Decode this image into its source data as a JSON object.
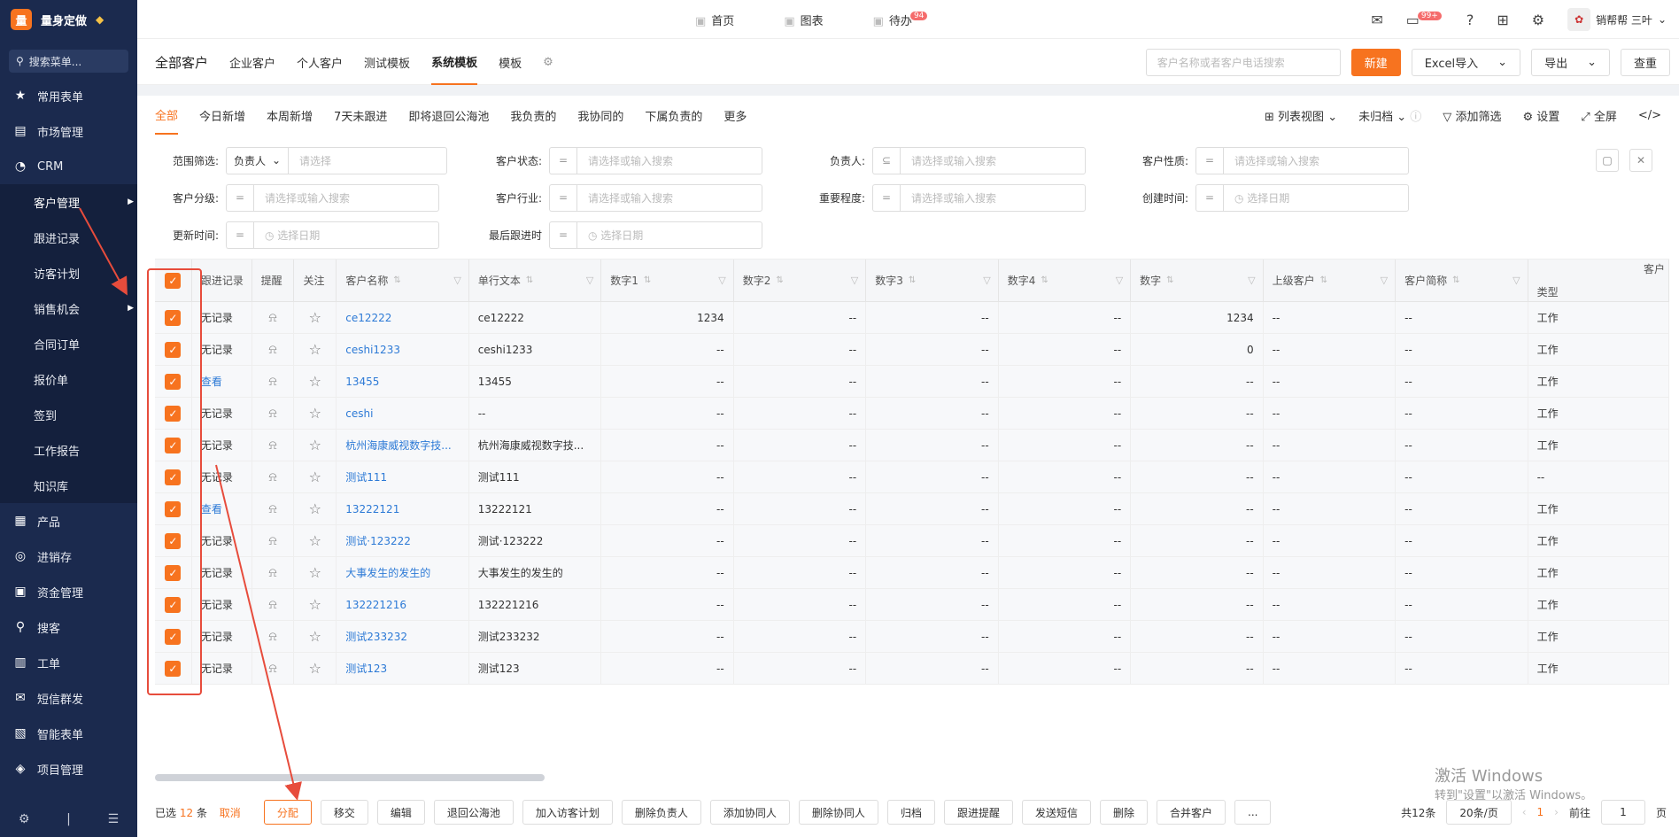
{
  "sidebar": {
    "logo_badge": "量",
    "logo_text": "量身定做",
    "search_placeholder": "搜索菜单...",
    "items": [
      {
        "label": "常用表单",
        "icon": "star-icon",
        "glyph": "★"
      },
      {
        "label": "市场管理",
        "icon": "clipboard-icon",
        "glyph": "▤"
      },
      {
        "label": "CRM",
        "icon": "pie-chart-icon",
        "glyph": "◔"
      }
    ],
    "crm_sub": [
      "客户管理",
      "跟进记录",
      "访客计划",
      "销售机会",
      "合同订单",
      "报价单",
      "签到",
      "工作报告",
      "知识库"
    ],
    "items2": [
      {
        "label": "产品",
        "icon": "cubes-icon",
        "glyph": "▦"
      },
      {
        "label": "进销存",
        "icon": "box-icon",
        "glyph": "◎"
      },
      {
        "label": "资金管理",
        "icon": "money-icon",
        "glyph": "▣"
      },
      {
        "label": "搜客",
        "icon": "search-icon",
        "glyph": "⚲"
      },
      {
        "label": "工单",
        "icon": "ticket-icon",
        "glyph": "▥"
      },
      {
        "label": "短信群发",
        "icon": "mail-icon",
        "glyph": "✉"
      },
      {
        "label": "智能表单",
        "icon": "form-icon",
        "glyph": "▧"
      },
      {
        "label": "项目管理",
        "icon": "layers-icon",
        "glyph": "◈"
      }
    ]
  },
  "topnav": [
    {
      "label": "首页",
      "icon": "home-icon"
    },
    {
      "label": "图表",
      "icon": "chart-icon"
    },
    {
      "label": "待办",
      "icon": "todo-icon",
      "badge": "94"
    }
  ],
  "topright": {
    "msg_badge": "99+",
    "user": "销帮帮 三叶"
  },
  "tabs": [
    "全部客户",
    "企业客户",
    "个人客户",
    "测试模板",
    "系统模板",
    "模板"
  ],
  "toolbar": {
    "search_placeholder": "客户名称或者客户电话搜索",
    "new": "新建",
    "excel": "Excel导入",
    "export": "导出",
    "dedup": "查重"
  },
  "filtertabs": [
    "全部",
    "今日新增",
    "本周新增",
    "7天未跟进",
    "即将退回公海池",
    "我负责的",
    "我协同的",
    "下属负责的",
    "更多"
  ],
  "ftools": {
    "view": "列表视图",
    "archive": "未归档",
    "add_filter": "添加筛选",
    "settings": "设置",
    "fullscreen": "全屏"
  },
  "filters": [
    [
      {
        "label": "范围筛选:",
        "op": "负责人",
        "placeholder": "请选择"
      },
      {
        "label": "客户状态:",
        "op": "=",
        "placeholder": "请选择或输入搜索"
      },
      {
        "label": "负责人:",
        "op": "⊆",
        "placeholder": "请选择或输入搜索"
      },
      {
        "label": "客户性质:",
        "op": "=",
        "placeholder": "请选择或输入搜索"
      }
    ],
    [
      {
        "label": "客户分级:",
        "op": "=",
        "placeholder": "请选择或输入搜索"
      },
      {
        "label": "客户行业:",
        "op": "=",
        "placeholder": "请选择或输入搜索"
      },
      {
        "label": "重要程度:",
        "op": "=",
        "placeholder": "请选择或输入搜索"
      },
      {
        "label": "创建时间:",
        "op": "=",
        "placeholder": "◷ 选择日期"
      }
    ],
    [
      {
        "label": "更新时间:",
        "op": "=",
        "placeholder": "◷ 选择日期"
      },
      {
        "label": "最后跟进时",
        "op": "=",
        "placeholder": "◷ 选择日期"
      }
    ]
  ],
  "columns": [
    "跟进记录",
    "提醒",
    "关注",
    "客户名称",
    "单行文本",
    "数字1",
    "数字2",
    "数字3",
    "数字4",
    "数字",
    "上级客户",
    "客户简称",
    "类型"
  ],
  "column_group": "客户",
  "rows": [
    {
      "follow": "无记录",
      "name": "ce12222",
      "text": "ce12222",
      "n1": "1234",
      "n2": "--",
      "n3": "--",
      "n4": "--",
      "n": "1234",
      "parent": "--",
      "short": "--",
      "type": "工作"
    },
    {
      "follow": "无记录",
      "name": "ceshi1233",
      "text": "ceshi1233",
      "n1": "--",
      "n2": "--",
      "n3": "--",
      "n4": "--",
      "n": "0",
      "parent": "--",
      "short": "--",
      "type": "工作"
    },
    {
      "follow": "查看",
      "name": "13455",
      "text": "13455",
      "n1": "--",
      "n2": "--",
      "n3": "--",
      "n4": "--",
      "n": "--",
      "parent": "--",
      "short": "--",
      "type": "工作"
    },
    {
      "follow": "无记录",
      "name": "ceshi",
      "text": "--",
      "n1": "--",
      "n2": "--",
      "n3": "--",
      "n4": "--",
      "n": "--",
      "parent": "--",
      "short": "--",
      "type": "工作"
    },
    {
      "follow": "无记录",
      "name": "杭州海康威视数字技...",
      "text": "杭州海康威视数字技...",
      "n1": "--",
      "n2": "--",
      "n3": "--",
      "n4": "--",
      "n": "--",
      "parent": "--",
      "short": "--",
      "type": "工作"
    },
    {
      "follow": "无记录",
      "name": "测试111",
      "text": "测试111",
      "n1": "--",
      "n2": "--",
      "n3": "--",
      "n4": "--",
      "n": "--",
      "parent": "--",
      "short": "--",
      "type": "--"
    },
    {
      "follow": "查看",
      "name": "13222121",
      "text": "13222121",
      "n1": "--",
      "n2": "--",
      "n3": "--",
      "n4": "--",
      "n": "--",
      "parent": "--",
      "short": "--",
      "type": "工作"
    },
    {
      "follow": "无记录",
      "name": "测试·123222",
      "text": "测试·123222",
      "n1": "--",
      "n2": "--",
      "n3": "--",
      "n4": "--",
      "n": "--",
      "parent": "--",
      "short": "--",
      "type": "工作"
    },
    {
      "follow": "无记录",
      "name": "大事发生的发生的",
      "text": "大事发生的发生的",
      "n1": "--",
      "n2": "--",
      "n3": "--",
      "n4": "--",
      "n": "--",
      "parent": "--",
      "short": "--",
      "type": "工作"
    },
    {
      "follow": "无记录",
      "name": "132221216",
      "text": "132221216",
      "n1": "--",
      "n2": "--",
      "n3": "--",
      "n4": "--",
      "n": "--",
      "parent": "--",
      "short": "--",
      "type": "工作"
    },
    {
      "follow": "无记录",
      "name": "测试233232",
      "text": "测试233232",
      "n1": "--",
      "n2": "--",
      "n3": "--",
      "n4": "--",
      "n": "--",
      "parent": "--",
      "short": "--",
      "type": "工作"
    },
    {
      "follow": "无记录",
      "name": "测试123",
      "text": "测试123",
      "n1": "--",
      "n2": "--",
      "n3": "--",
      "n4": "--",
      "n": "--",
      "parent": "--",
      "short": "--",
      "type": "工作"
    }
  ],
  "bottom": {
    "selected_prefix": "已选",
    "selected_count": "12",
    "selected_suffix": "条",
    "cancel": "取消",
    "actions": [
      "分配",
      "移交",
      "编辑",
      "退回公海池",
      "加入访客计划",
      "删除负责人",
      "添加协同人",
      "删除协同人",
      "归档",
      "跟进提醒",
      "发送短信",
      "删除",
      "合并客户",
      "..."
    ],
    "total": "共12条",
    "page_size": "20条/页",
    "page": "1",
    "goto_label": "前往",
    "goto_value": "1",
    "goto_suffix": "页"
  },
  "watermark": {
    "line1": "激活 Windows",
    "line2": "转到\"设置\"以激活 Windows。"
  },
  "colors": {
    "accent": "#f7731f",
    "sidebar": "#1b2a4e",
    "link": "#2d7ad6",
    "annotation": "#e74c3c"
  }
}
